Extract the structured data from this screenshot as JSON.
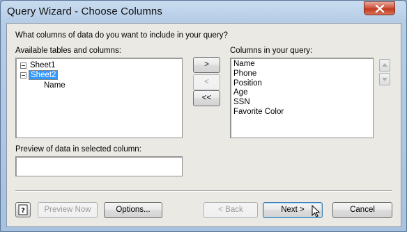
{
  "window": {
    "title": "Query Wizard - Choose Columns"
  },
  "prompt": "What columns of data do you want to include in your query?",
  "available": {
    "label": "Available tables and columns:",
    "tree": [
      {
        "label": "Sheet1",
        "expanded": true,
        "selected": false
      },
      {
        "label": "Sheet2",
        "expanded": true,
        "selected": true,
        "children": [
          "Name"
        ]
      }
    ]
  },
  "move_buttons": {
    "add": ">",
    "remove": "<",
    "remove_all": "<<"
  },
  "columns": {
    "label": "Columns in your query:",
    "items": [
      "Name",
      "Phone",
      "Position",
      "Age",
      "SSN",
      "Favorite Color"
    ]
  },
  "preview": {
    "label": "Preview of data in selected column:",
    "value": ""
  },
  "footer": {
    "preview_now": "Preview Now",
    "options": "Options...",
    "back": "< Back",
    "next": "Next >",
    "cancel": "Cancel"
  },
  "colors": {
    "selection": "#3399ff",
    "dialog_bg": "#ebe9e3",
    "close_button": "#c13a20"
  },
  "icons": [
    "close-icon",
    "help-icon",
    "move-up-icon",
    "move-down-icon",
    "collapse-icon",
    "mouse-cursor-icon"
  ]
}
